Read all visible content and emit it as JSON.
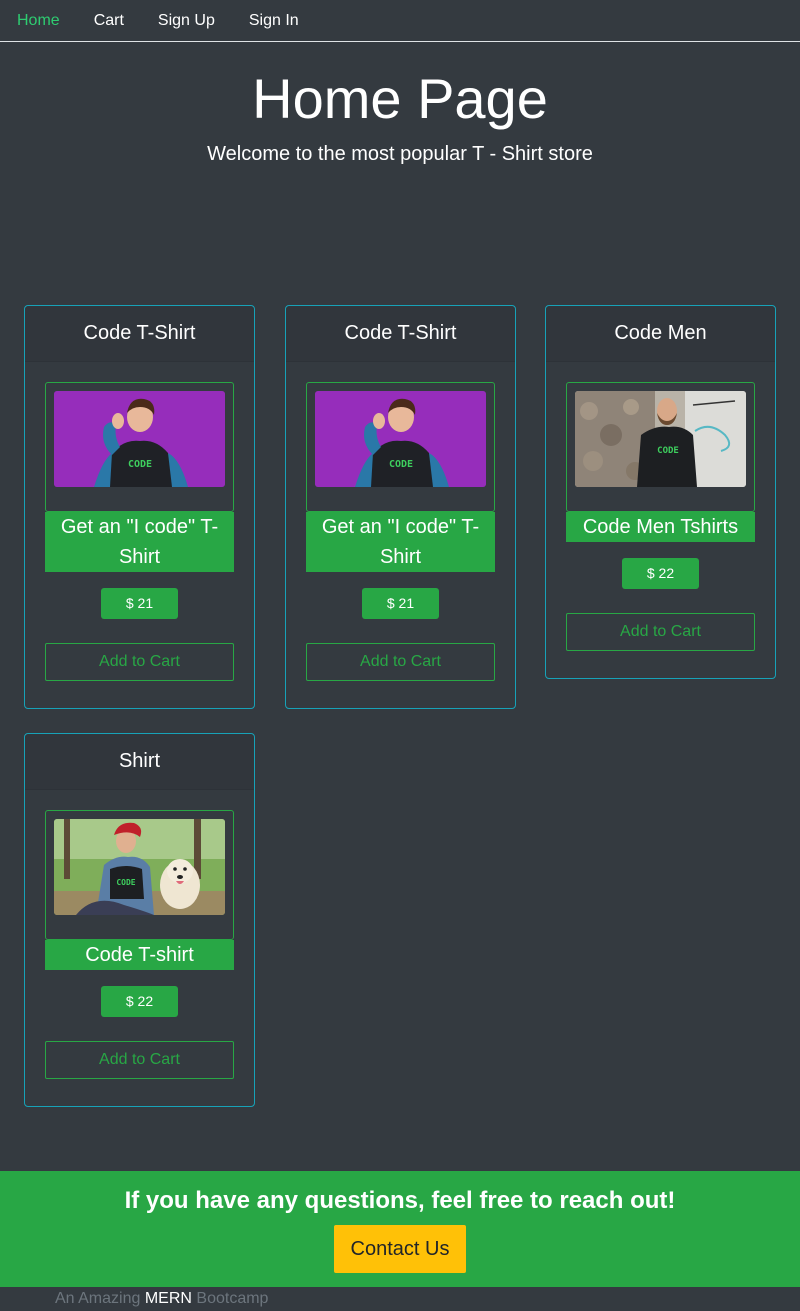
{
  "nav": {
    "items": [
      {
        "label": "Home",
        "active": true
      },
      {
        "label": "Cart",
        "active": false
      },
      {
        "label": "Sign Up",
        "active": false
      },
      {
        "label": "Sign In",
        "active": false
      }
    ]
  },
  "hero": {
    "title": "Home Page",
    "subtitle": "Welcome to the most popular T - Shirt store"
  },
  "products": [
    {
      "name": "Code T-Shirt",
      "description": "Get an \"I code\" T-Shirt",
      "price": "$ 21",
      "button": "Add to Cart",
      "image_icon": "woman-purple-tshirt-image"
    },
    {
      "name": "Code T-Shirt",
      "description": "Get an \"I code\" T-Shirt",
      "price": "$ 21",
      "button": "Add to Cart",
      "image_icon": "woman-purple-tshirt-image"
    },
    {
      "name": "Code Men",
      "description": "Code Men Tshirts",
      "price": "$ 22",
      "button": "Add to Cart",
      "image_icon": "man-wall-tshirt-image"
    },
    {
      "name": "Shirt",
      "description": "Code T-shirt",
      "price": "$ 22",
      "button": "Add to Cart",
      "image_icon": "woman-dog-tshirt-image"
    }
  ],
  "footer": {
    "title": "If you have any questions, feel free to reach out!",
    "contact_button": "Contact Us",
    "tagline_prefix": "An Amazing",
    "tagline_brand": "MERN",
    "tagline_suffix": "Bootcamp"
  },
  "colors": {
    "background": "#343a40",
    "accent_green": "#28a745",
    "card_border": "#17a2b8",
    "contact_yellow": "#ffc107",
    "nav_active": "#2ecc71"
  }
}
